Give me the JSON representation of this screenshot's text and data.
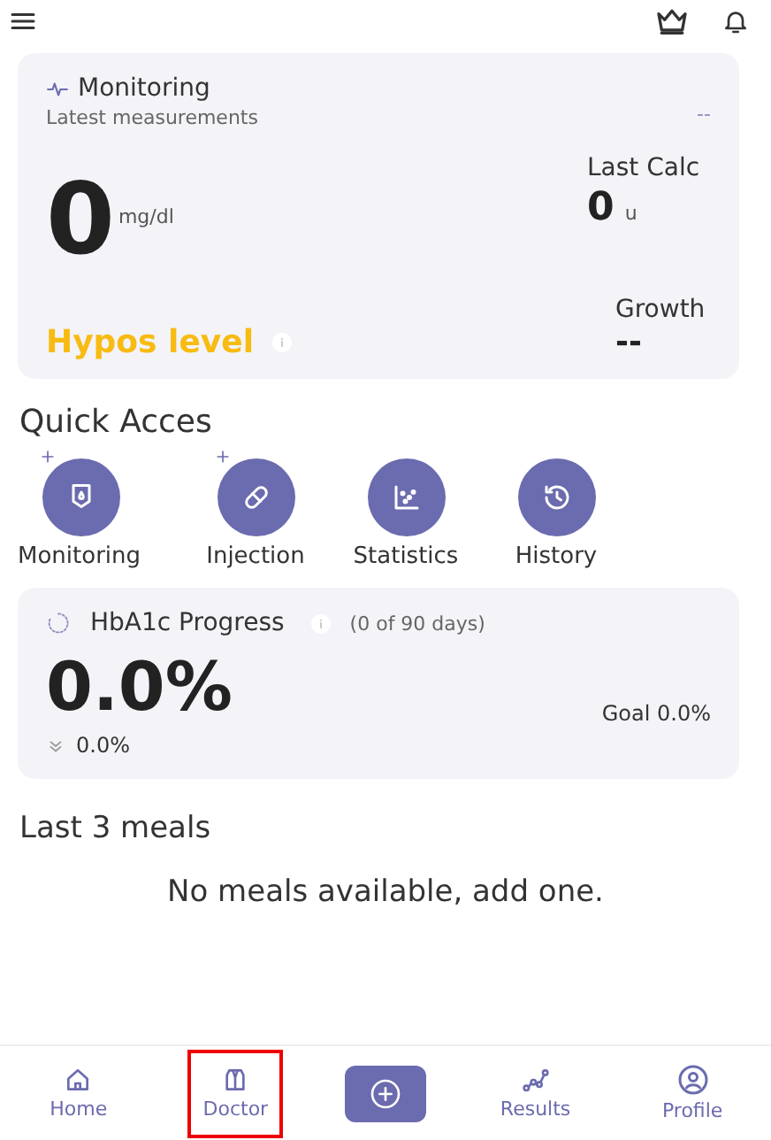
{
  "monitoring_card": {
    "title": "Monitoring",
    "subtitle": "Latest measurements",
    "corner_value": "--",
    "glucose_value": "0",
    "glucose_unit": "mg/dl",
    "last_calc_label": "Last Calc",
    "last_calc_value": "0",
    "last_calc_unit": "u",
    "hypos_label": "Hypos level",
    "growth_label": "Growth",
    "growth_value": "--"
  },
  "quick_access": {
    "title": "Quick Acces",
    "items": [
      {
        "kind": "drip",
        "label": "Monitoring",
        "addable": true
      },
      {
        "kind": "pill",
        "label": "Injection",
        "addable": true
      },
      {
        "kind": "stats",
        "label": "Statistics",
        "addable": false
      },
      {
        "kind": "history",
        "label": "History",
        "addable": false
      }
    ]
  },
  "hba1c_card": {
    "title": "HbA1c Progress",
    "days": "(0 of 90 days)",
    "value": "0.0%",
    "change": "0.0%",
    "goal": "Goal 0.0%"
  },
  "meals": {
    "title": "Last 3 meals",
    "empty_text": "No meals available, add one."
  },
  "bottom_nav": [
    {
      "kind": "home",
      "label": "Home",
      "highlighted": false
    },
    {
      "kind": "doctor",
      "label": "Doctor",
      "highlighted": true
    },
    {
      "kind": "add",
      "highlighted": false
    },
    {
      "kind": "results",
      "label": "Results",
      "highlighted": false
    },
    {
      "kind": "profile",
      "label": "Profile",
      "highlighted": false
    }
  ]
}
